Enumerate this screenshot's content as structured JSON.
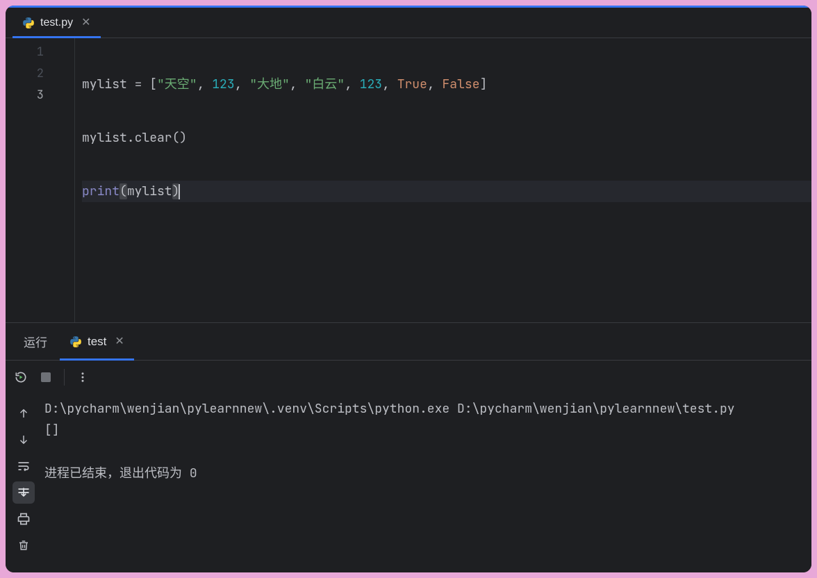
{
  "tabs": {
    "editor": {
      "label": "test.py"
    },
    "run_panel_label": "运行",
    "run_tab": {
      "label": "test"
    }
  },
  "code": {
    "lines": [
      "1",
      "2",
      "3"
    ],
    "l1_pre": "mylist = [",
    "l1_s1": "\"天空\"",
    "l1_c1": ", ",
    "l1_n1": "123",
    "l1_c2": ", ",
    "l1_s2": "\"大地\"",
    "l1_c3": ", ",
    "l1_s3": "\"白云\"",
    "l1_c4": ", ",
    "l1_n2": "123",
    "l1_c5": ", ",
    "l1_k1": "True",
    "l1_c6": ", ",
    "l1_k2": "False",
    "l1_close": "]",
    "l2": "mylist.clear()",
    "l3_fn": "print",
    "l3_open": "(",
    "l3_arg": "mylist",
    "l3_close": ")"
  },
  "console": {
    "cmd": "D:\\pycharm\\wenjian\\pylearnnew\\.venv\\Scripts\\python.exe D:\\pycharm\\wenjian\\pylearnnew\\test.py",
    "output": "[]",
    "exit_msg": "进程已结束，退出代码为 ",
    "exit_code": "0"
  },
  "icons": {
    "python": "python-icon",
    "close": "close-icon",
    "rerun": "rerun-icon",
    "stop": "stop-icon",
    "more": "more-icon",
    "up": "arrow-up-icon",
    "down": "arrow-down-icon",
    "wrap": "soft-wrap-icon",
    "scroll": "scroll-end-icon",
    "print": "print-icon",
    "trash": "trash-icon"
  }
}
